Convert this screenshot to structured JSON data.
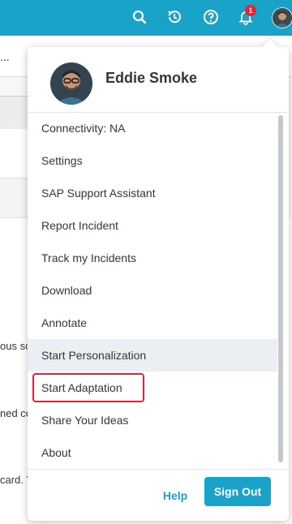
{
  "shellbar": {
    "bg_color": "#1aa3c8",
    "icons": [
      "search-icon",
      "history-icon",
      "help-icon",
      "notification-bell-icon"
    ],
    "notification_count": "1"
  },
  "background": {
    "ellipsis_left": "...",
    "ellipsis_right": ".",
    "fragments": [
      "ous so",
      "ned co",
      "card. Y"
    ]
  },
  "user": {
    "name": "Eddie Smoke"
  },
  "menu": {
    "items": [
      {
        "label": "Connectivity: NA"
      },
      {
        "label": "Settings"
      },
      {
        "label": "SAP Support Assistant"
      },
      {
        "label": "Report Incident"
      },
      {
        "label": "Track my Incidents"
      },
      {
        "label": "Download"
      },
      {
        "label": "Annotate"
      },
      {
        "label": "Start Personalization"
      },
      {
        "label": "Start Adaptation"
      },
      {
        "label": "Share Your Ideas"
      },
      {
        "label": "About"
      }
    ],
    "hovered_item": "Start Personalization",
    "highlighted_item": "Start Adaptation",
    "highlight_color": "#e0263a"
  },
  "footer": {
    "help_label": "Help",
    "signout_label": "Sign Out",
    "accent_color": "#1aa3c8"
  }
}
